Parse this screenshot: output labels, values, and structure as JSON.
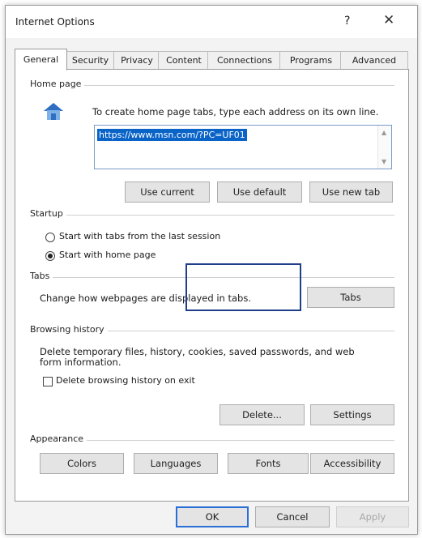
{
  "window": {
    "title": "Internet Options",
    "help_glyph": "?",
    "close_glyph": "✕"
  },
  "tabs": [
    {
      "label": "General",
      "active": true
    },
    {
      "label": "Security"
    },
    {
      "label": "Privacy"
    },
    {
      "label": "Content"
    },
    {
      "label": "Connections"
    },
    {
      "label": "Programs"
    },
    {
      "label": "Advanced"
    }
  ],
  "home_page": {
    "group_label": "Home page",
    "instruction": "To create home page tabs, type each address on its own line.",
    "url": "https://www.msn.com/?PC=UF01",
    "buttons": {
      "use_current": "Use current",
      "use_default": "Use default",
      "use_new_tab": "Use new tab"
    }
  },
  "startup": {
    "group_label": "Startup",
    "options": [
      {
        "label": "Start with tabs from the last session",
        "selected": false
      },
      {
        "label": "Start with home page",
        "selected": true
      }
    ]
  },
  "tabs_group": {
    "group_label": "Tabs",
    "description": "Change how webpages are displayed in tabs.",
    "button": "Tabs"
  },
  "browsing_history": {
    "group_label": "Browsing history",
    "description_line1": "Delete temporary files, history, cookies, saved passwords, and web",
    "description_line2": "form information.",
    "checkbox_label": "Delete browsing history on exit",
    "checkbox_checked": false,
    "delete_button": "Delete...",
    "settings_button": "Settings"
  },
  "appearance": {
    "group_label": "Appearance",
    "buttons": {
      "colors": "Colors",
      "languages": "Languages",
      "fonts": "Fonts",
      "accessibility": "Accessibility"
    }
  },
  "footer": {
    "ok": "OK",
    "cancel": "Cancel",
    "apply": "Apply"
  },
  "colors": {
    "accent": "#2a6fd6",
    "selection": "#0a64c8",
    "highlight_box": "#1f3f8a"
  }
}
